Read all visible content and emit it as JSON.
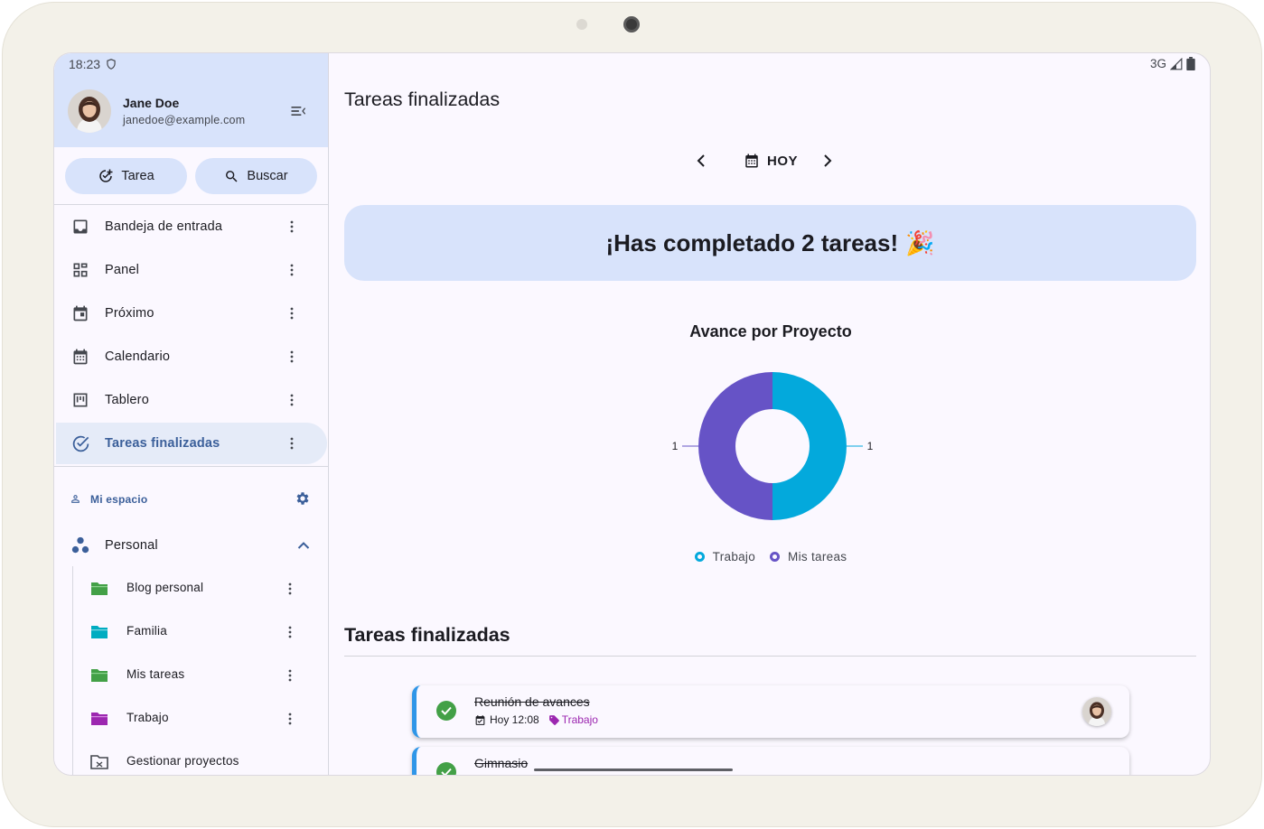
{
  "status": {
    "time": "18:23",
    "network": "3G"
  },
  "user": {
    "name": "Jane Doe",
    "email": "janedoe@example.com"
  },
  "actions": {
    "task_label": "Tarea",
    "search_label": "Buscar"
  },
  "nav": [
    {
      "label": "Bandeja de entrada",
      "icon": "inbox-icon"
    },
    {
      "label": "Panel",
      "icon": "dashboard-icon"
    },
    {
      "label": "Próximo",
      "icon": "calendar-event-icon"
    },
    {
      "label": "Calendario",
      "icon": "calendar-month-icon"
    },
    {
      "label": "Tablero",
      "icon": "kanban-icon"
    },
    {
      "label": "Tareas finalizadas",
      "icon": "check-circle-icon",
      "active": true
    }
  ],
  "workspace": {
    "label": "Mi espacio"
  },
  "projects_group": {
    "label": "Personal"
  },
  "projects": [
    {
      "label": "Blog personal",
      "color": "#43a047"
    },
    {
      "label": "Familia",
      "color": "#00acc1"
    },
    {
      "label": "Mis tareas",
      "color": "#43a047"
    },
    {
      "label": "Trabajo",
      "color": "#9c27b0"
    },
    {
      "label": "Gestionar proyectos",
      "color": "#44474e"
    }
  ],
  "main": {
    "title": "Tareas finalizadas",
    "date_label": "HOY",
    "banner": "¡Has completado 2 tareas!",
    "banner_emoji": "🎉",
    "section_title": "Tareas finalizadas"
  },
  "chart_data": {
    "type": "pie",
    "title": "Avance por Proyecto",
    "categories": [
      "Trabajo",
      "Mis tareas"
    ],
    "values": [
      1,
      1
    ],
    "colors": [
      "#03a9dc",
      "#6653c6"
    ],
    "donut": true,
    "legend": "bottom"
  },
  "tasks": [
    {
      "title": "Reunión de avances",
      "time": "Hoy 12:08",
      "tag": "Trabajo",
      "border_color": "#2f96e8"
    },
    {
      "title": "Gimnasio",
      "border_color": "#2f96e8"
    }
  ],
  "colors": {
    "accent": "#d8e3fb",
    "primary": "#3b5f9a",
    "done": "#43a047"
  }
}
